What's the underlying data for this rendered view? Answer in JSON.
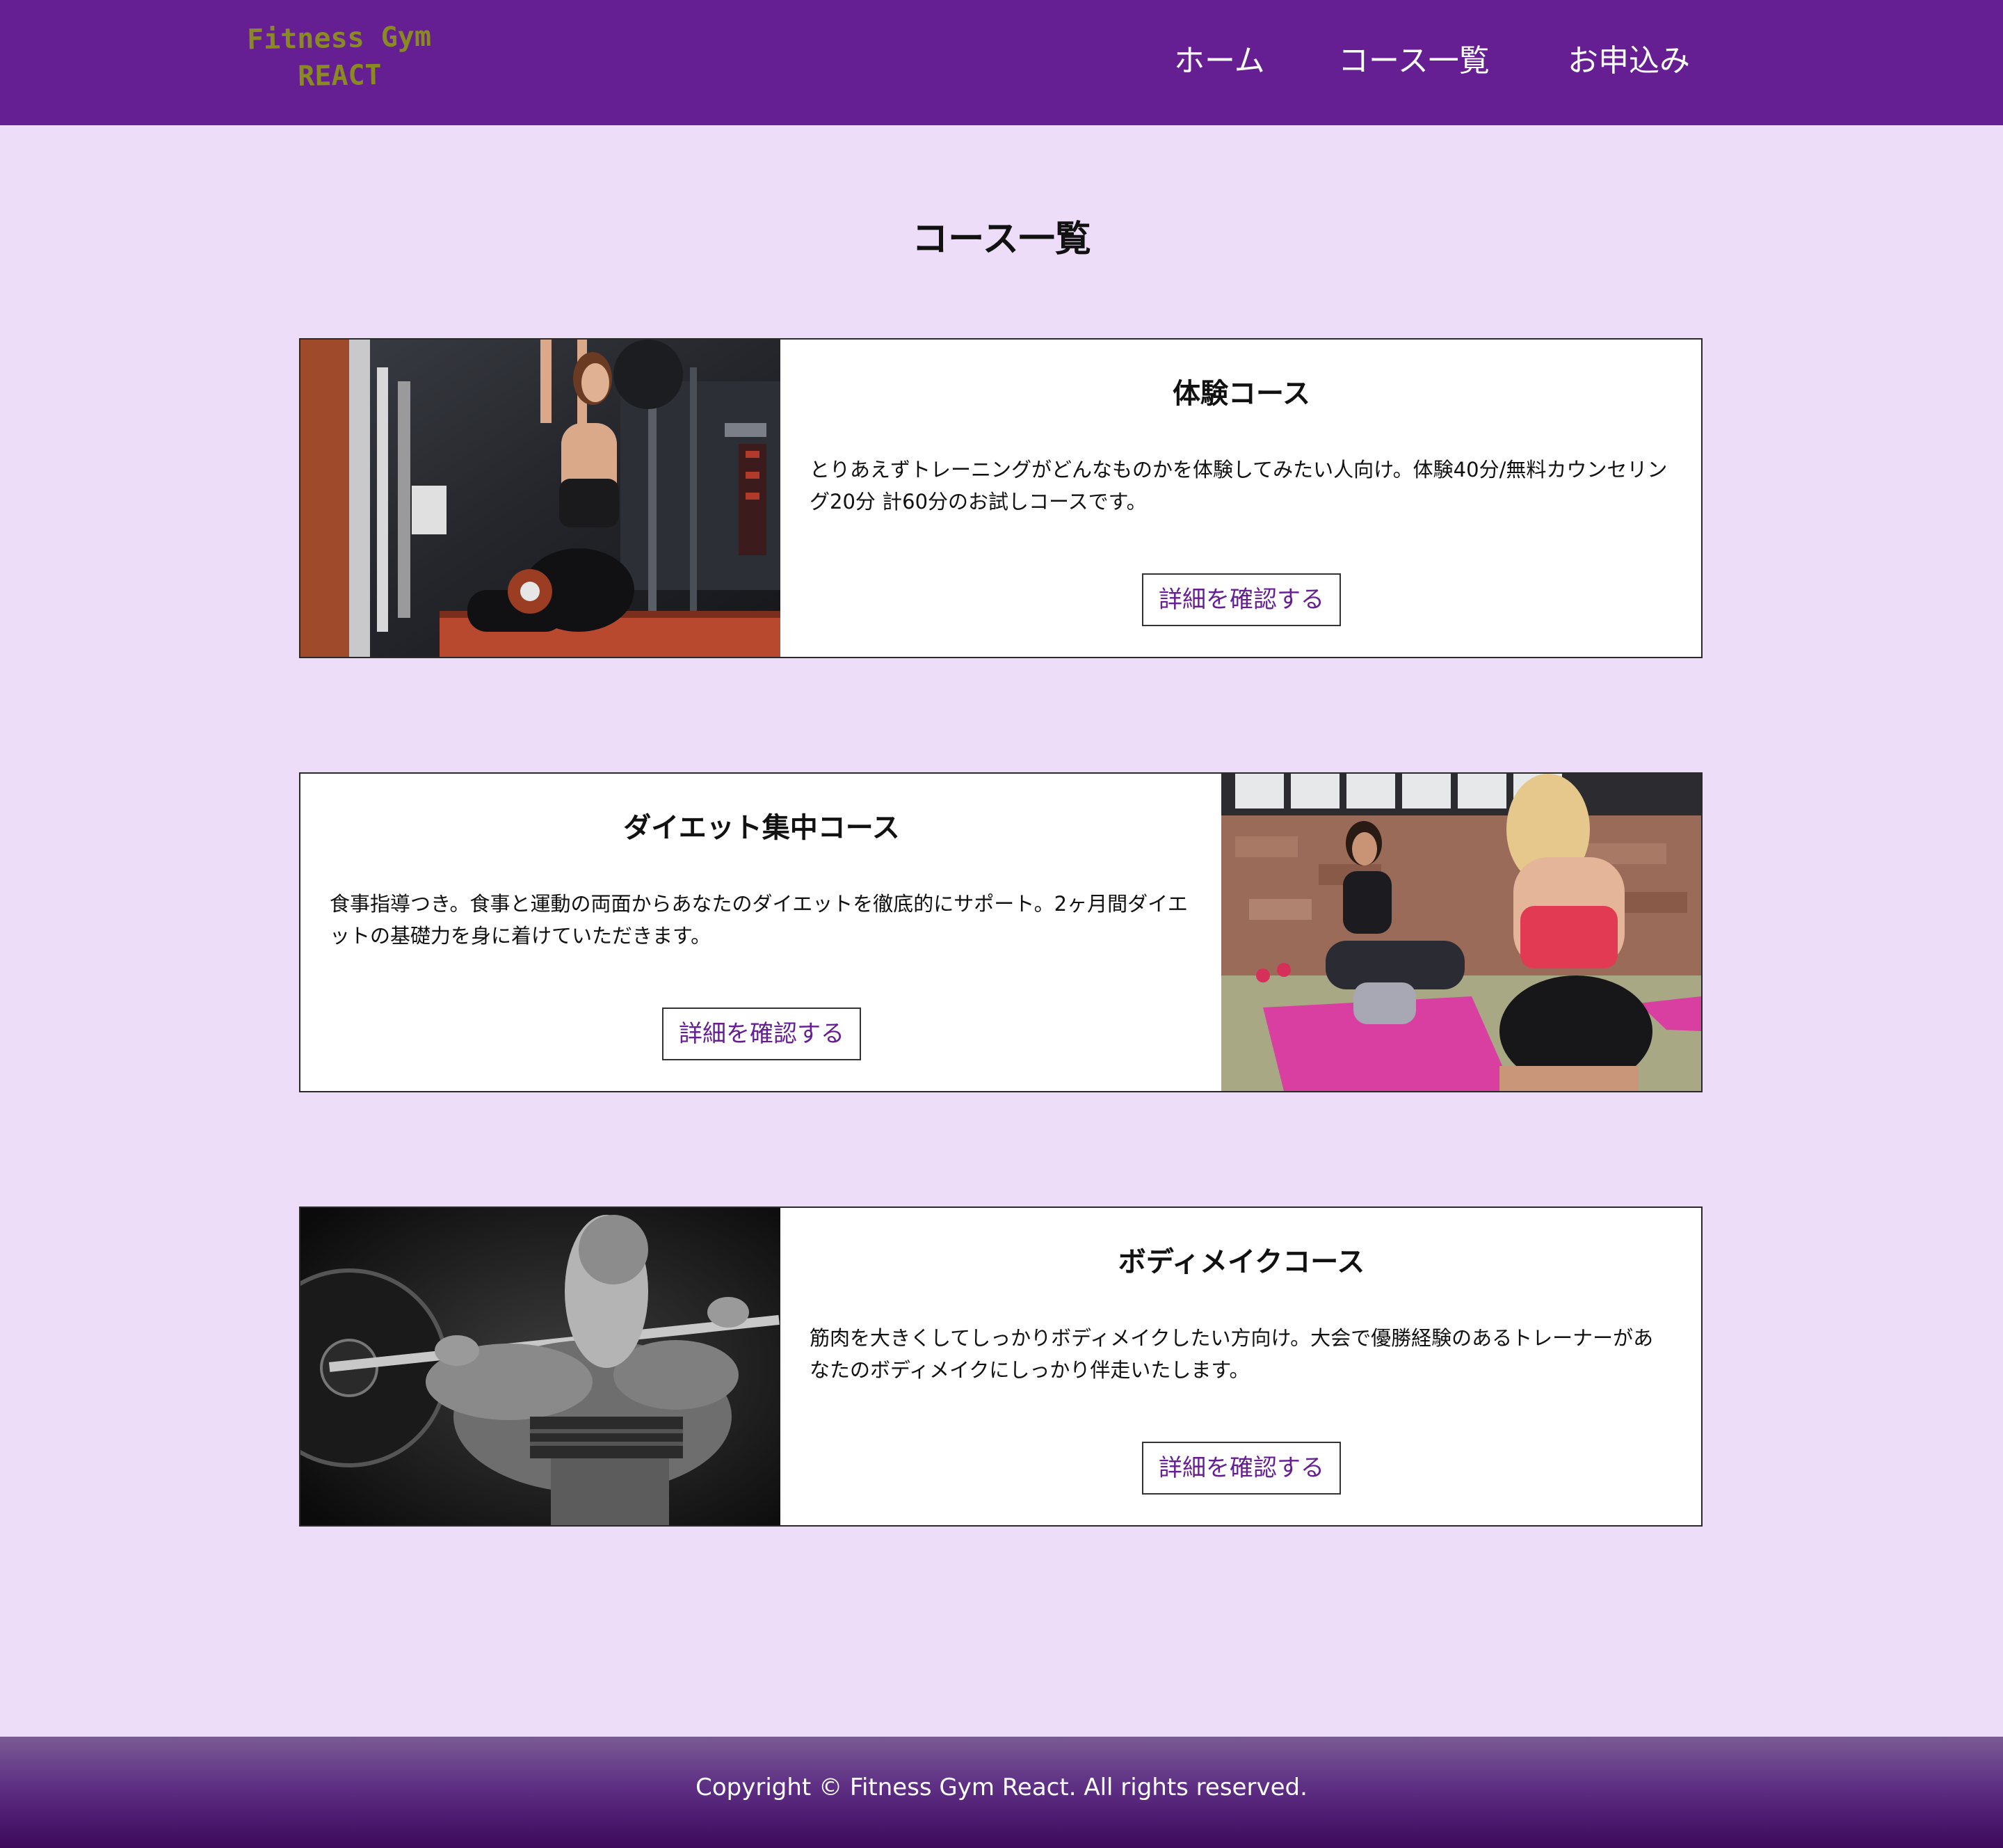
{
  "header": {
    "logo_line1": "Fitness Gym",
    "logo_line2": "REACT",
    "nav": {
      "home": "ホーム",
      "courses": "コース一覧",
      "apply": "お申込み"
    }
  },
  "main": {
    "title": "コース一覧",
    "courses": [
      {
        "title": "体験コース",
        "description": "とりあえずトレーニングがどんなものかを体験してみたい人向け。体験40分/無料カウンセリング20分 計60分のお試しコースです。",
        "button": "詳細を確認する"
      },
      {
        "title": "ダイエット集中コース",
        "description": "食事指導つき。食事と運動の両面からあなたのダイエットを徹底的にサポート。2ヶ月間ダイエットの基礎力を身に着けていただきます。",
        "button": "詳細を確認する"
      },
      {
        "title": "ボディメイクコース",
        "description": "筋肉を大きくしてしっかりボディメイクしたい方向け。大会で優勝経験のあるトレーナーがあなたのボディメイクにしっかり伴走いたします。",
        "button": "詳細を確認する"
      }
    ]
  },
  "footer": {
    "copyright": "Copyright © Fitness Gym React. All rights reserved."
  },
  "colors": {
    "header_bg": "#661f92",
    "page_bg": "#eeddf8",
    "accent": "#661f92",
    "logo": "#8a8a22",
    "footer_bottom": "#3d0a5c"
  }
}
